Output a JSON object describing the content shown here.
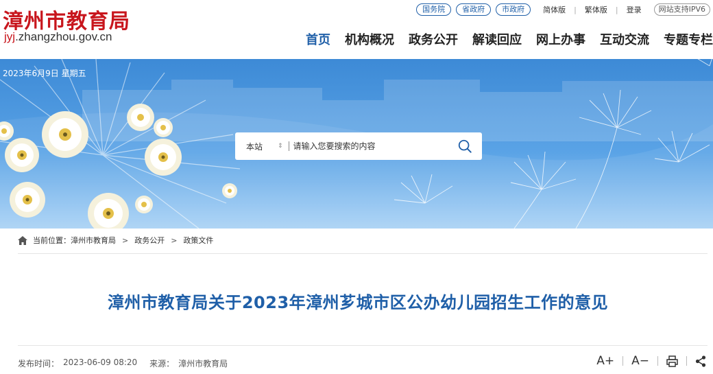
{
  "header": {
    "site_name": "漳州市教育局",
    "domain_prefix": "jyj",
    "domain_rest": ".zhangzhou.gov.cn",
    "top_links": {
      "state_council": "国务院",
      "province_gov": "省政府",
      "city_gov": "市政府",
      "simplified": "简体版",
      "traditional": "繁体版",
      "login": "登录",
      "ipv6": "网站支持IPV6"
    },
    "nav": [
      {
        "label": "首页",
        "active": true
      },
      {
        "label": "机构概况",
        "active": false
      },
      {
        "label": "政务公开",
        "active": false
      },
      {
        "label": "解读回应",
        "active": false
      },
      {
        "label": "网上办事",
        "active": false
      },
      {
        "label": "互动交流",
        "active": false
      },
      {
        "label": "专题专栏",
        "active": false
      }
    ]
  },
  "banner": {
    "date": "2023年6月9日 星期五",
    "search": {
      "scope": "本站",
      "placeholder": "请输入您要搜索的内容"
    }
  },
  "breadcrumb": {
    "prefix": "当前位置：",
    "items": [
      "漳州市教育局",
      "政务公开",
      "政策文件"
    ],
    "separator": ">"
  },
  "article": {
    "title": "漳州市教育局关于2023年漳州芗城市区公办幼儿园招生工作的意见",
    "publish_label": "发布时间：",
    "publish_time": "2023-06-09 08:20",
    "source_label": "来源：",
    "source": "漳州市教育局"
  },
  "tools": {
    "font_increase": "A+",
    "font_decrease": "A−"
  },
  "colors": {
    "brand_red": "#c8161d",
    "brand_blue": "#1f5fa8"
  }
}
